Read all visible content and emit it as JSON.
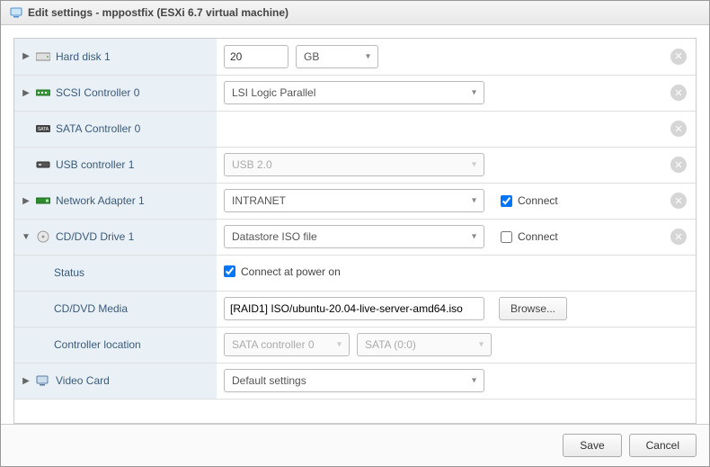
{
  "dialog": {
    "title": "Edit settings - mppostfix (ESXi 6.7 virtual machine)"
  },
  "rows": {
    "harddisk": {
      "label": "Hard disk 1",
      "value": "20",
      "unit": "GB"
    },
    "scsi": {
      "label": "SCSI Controller 0",
      "value": "LSI Logic Parallel"
    },
    "sata": {
      "label": "SATA Controller 0"
    },
    "usb": {
      "label": "USB controller 1",
      "value": "USB 2.0"
    },
    "nic": {
      "label": "Network Adapter 1",
      "value": "INTRANET",
      "connect_label": "Connect",
      "connect_checked": true
    },
    "cddvd": {
      "label": "CD/DVD Drive 1",
      "value": "Datastore ISO file",
      "connect_label": "Connect",
      "connect_checked": false
    },
    "status": {
      "label": "Status",
      "checkbox_label": "Connect at power on",
      "checked": true
    },
    "media": {
      "label": "CD/DVD Media",
      "value": "[RAID1] ISO/ubuntu-20.04-live-server-amd64.iso",
      "browse": "Browse..."
    },
    "ctrlloc": {
      "label": "Controller location",
      "controller": "SATA controller 0",
      "port": "SATA (0:0)"
    },
    "video": {
      "label": "Video Card",
      "value": "Default settings"
    }
  },
  "footer": {
    "save": "Save",
    "cancel": "Cancel"
  }
}
